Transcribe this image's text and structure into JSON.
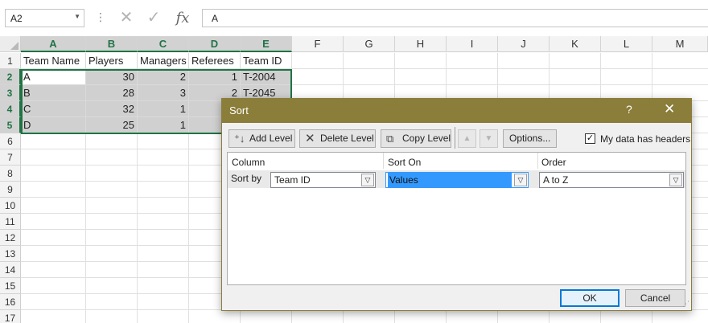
{
  "formula_bar": {
    "name_box": "A2",
    "cancel_icon": "✕",
    "enter_icon": "✓",
    "fx_label": "fx",
    "formula_value": "A"
  },
  "grid": {
    "columns": [
      "A",
      "B",
      "C",
      "D",
      "E",
      "F",
      "G",
      "H",
      "I",
      "J",
      "K",
      "L",
      "M"
    ],
    "rows": [
      "1",
      "2",
      "3",
      "4",
      "5",
      "6",
      "7",
      "8",
      "9",
      "10",
      "11",
      "12",
      "13",
      "14",
      "15",
      "16",
      "17"
    ],
    "data": [
      [
        "Team Name",
        "Players",
        "Managers",
        "Referees",
        "Team ID"
      ],
      [
        "A",
        "30",
        "2",
        "1",
        "T-2004"
      ],
      [
        "B",
        "28",
        "3",
        "2",
        "T-2045"
      ],
      [
        "C",
        "32",
        "1",
        "",
        ""
      ],
      [
        "D",
        "25",
        "1",
        "",
        ""
      ]
    ]
  },
  "dialog": {
    "title": "Sort",
    "help_icon": "?",
    "close_icon": "✕",
    "add_level": "Add Level",
    "delete_level": "Delete Level",
    "copy_level": "Copy Level",
    "move_up_icon": "▲",
    "move_down_icon": "▼",
    "options": "Options...",
    "headers_checkbox": {
      "label": "My data has headers",
      "checked": true,
      "mark": "✓"
    },
    "headers": {
      "column": "Column",
      "sort_on": "Sort On",
      "order": "Order"
    },
    "level": {
      "label": "Sort by",
      "column": "Team ID",
      "sort_on": "Values",
      "order": "A to Z"
    },
    "ok": "OK",
    "cancel": "Cancel"
  }
}
